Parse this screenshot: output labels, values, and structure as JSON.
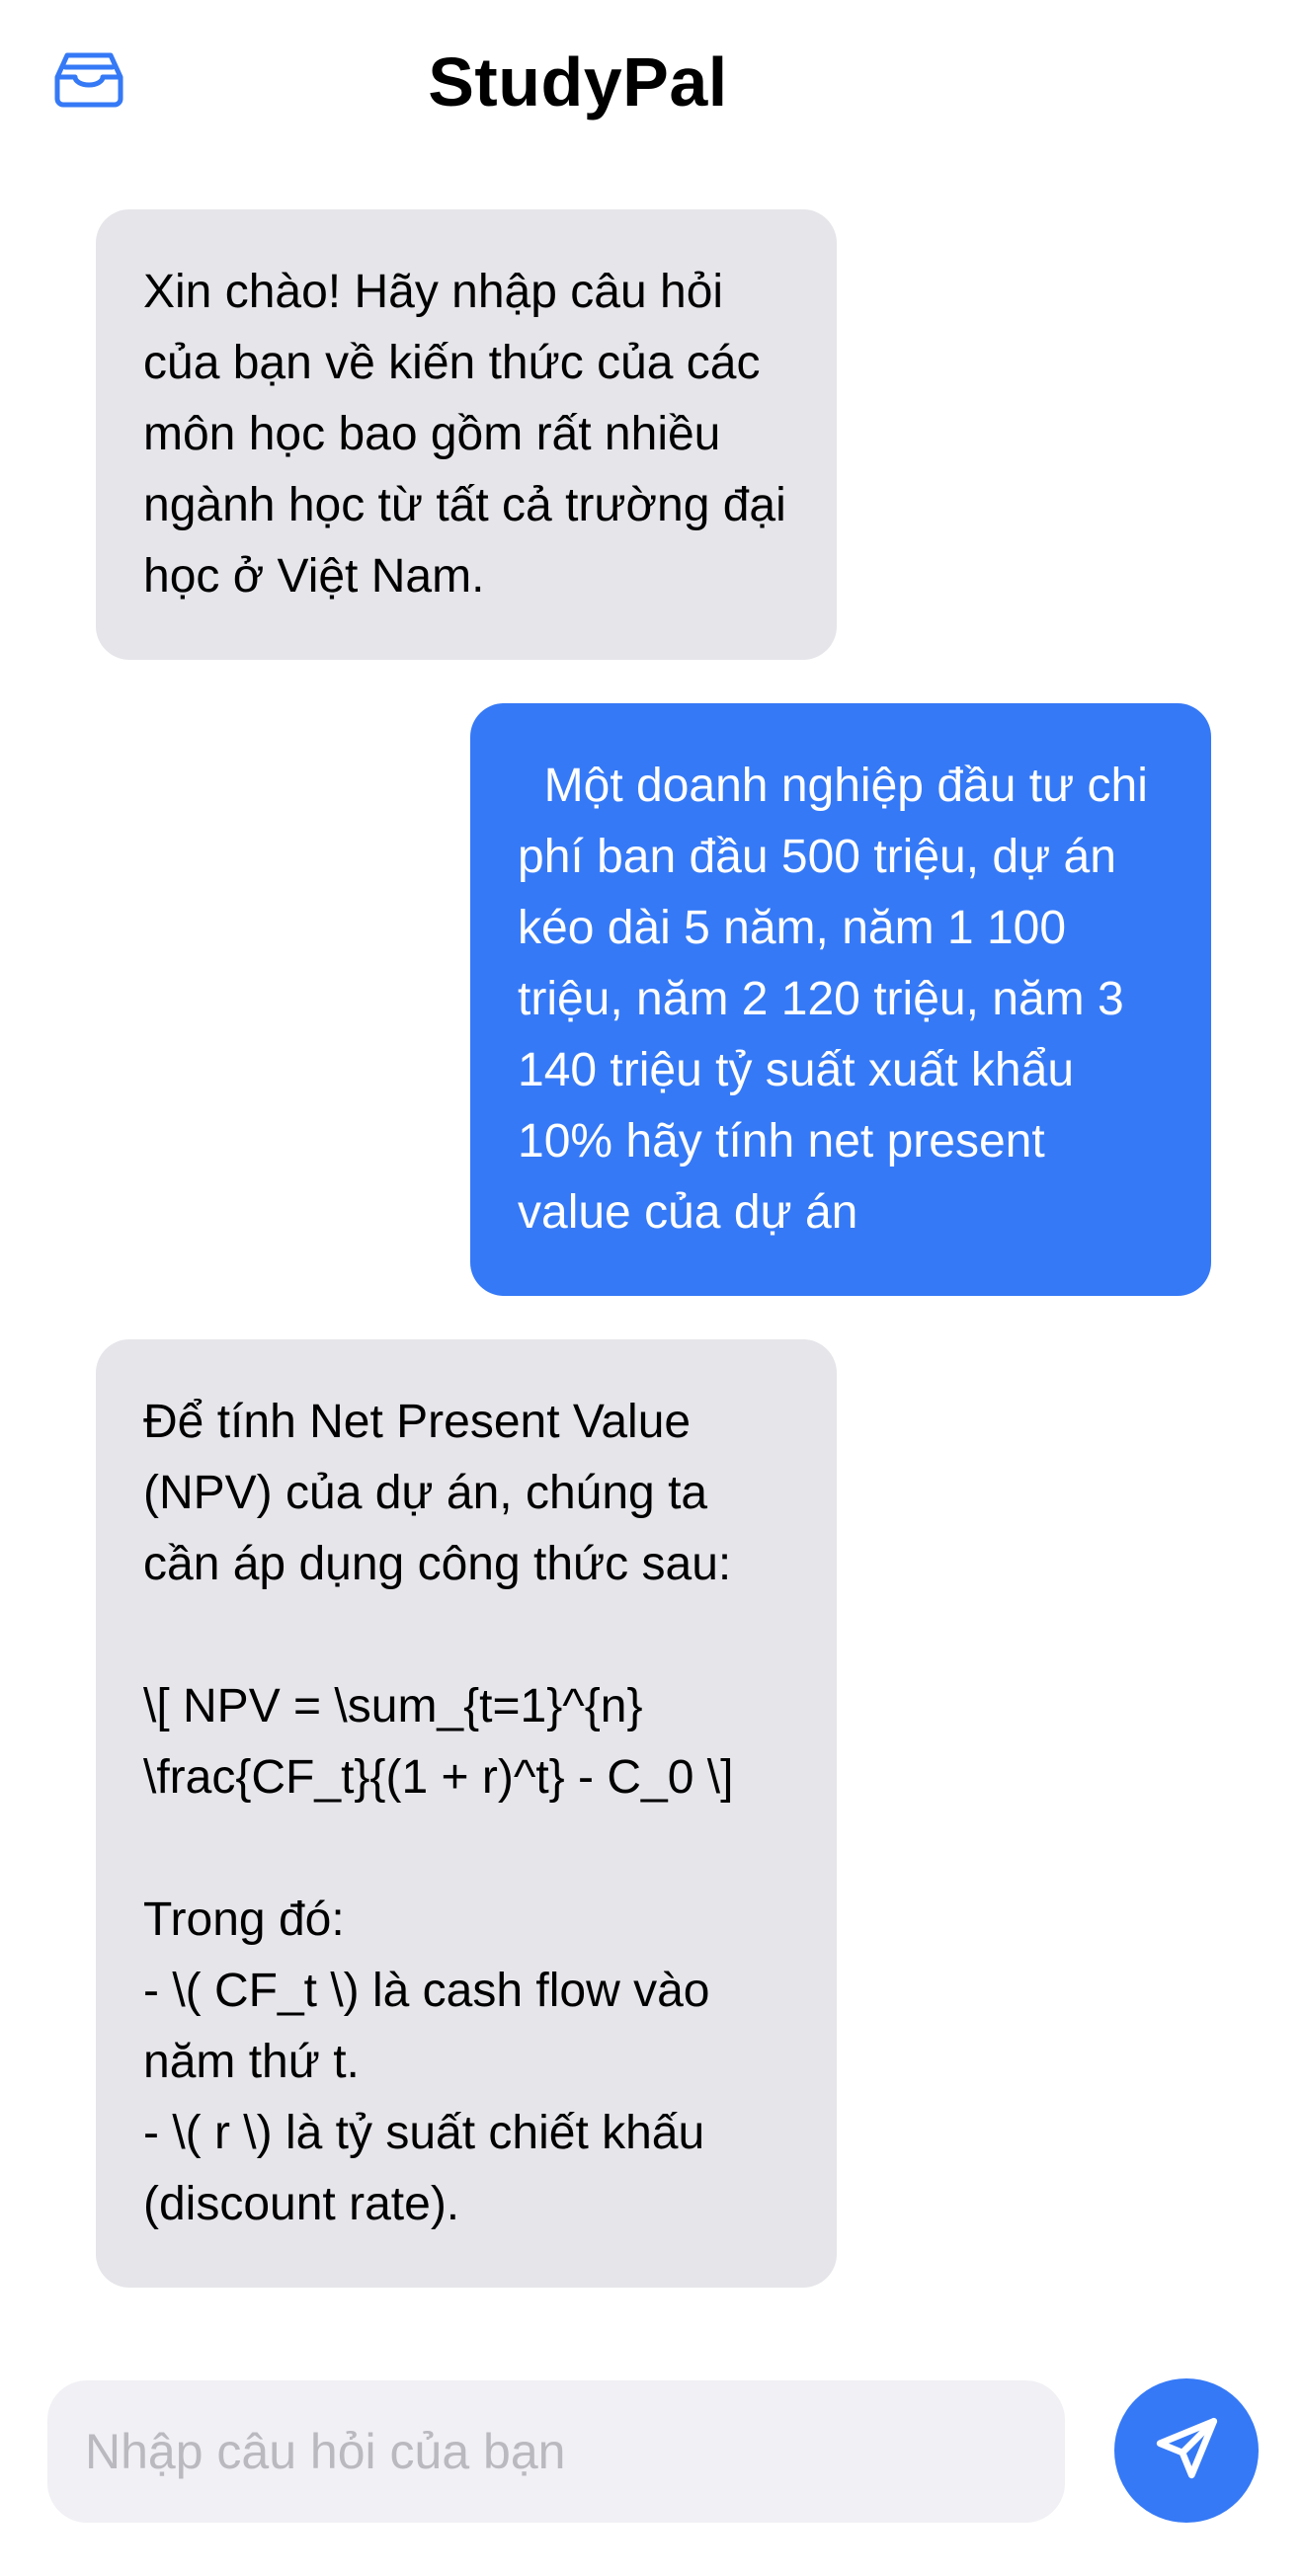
{
  "app": {
    "title": "StudyPal",
    "accent_color": "#3579f6"
  },
  "header": {
    "left_icon": "inbox-tray-icon"
  },
  "messages": [
    {
      "role": "assistant",
      "text": "Xin chào! Hãy nhập câu hỏi của bạn về kiến thức của các môn học bao gồm rất nhiều ngành học từ tất cả trường đại học ở Việt Nam."
    },
    {
      "role": "user",
      "text": "  Một doanh nghiệp đầu tư chi phí ban đầu 500 triệu, dự án kéo dài 5 năm, năm 1 100 triệu, năm 2 120 triệu, năm 3 140 triệu tỷ suất xuất khẩu 10% hãy tính net present value của dự án"
    },
    {
      "role": "assistant",
      "text": "Để tính Net Present Value (NPV) của dự án, chúng ta cần áp dụng công thức sau:\n\n\\[ NPV = \\sum_{t=1}^{n} \\frac{CF_t}{(1 + r)^t} - C_0 \\]\n\nTrong đó:\n- \\( CF_t \\) là cash flow vào năm thứ t.\n- \\( r \\) là tỷ suất chiết khấu (discount rate)."
    }
  ],
  "composer": {
    "placeholder": "Nhập câu hỏi của bạn",
    "value": "",
    "send_icon": "paper-plane-icon"
  }
}
